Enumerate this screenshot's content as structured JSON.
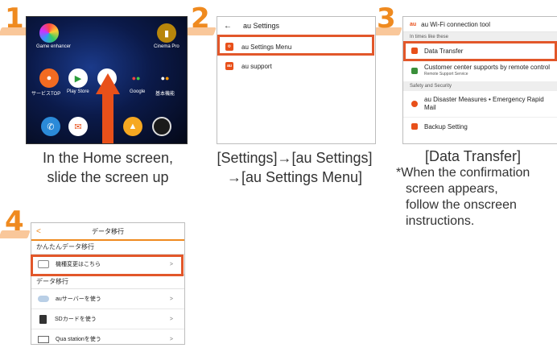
{
  "steps": [
    "1",
    "2",
    "3",
    "4"
  ],
  "home": {
    "top_apps": [
      "Game enhancer",
      "Cinema Pro"
    ],
    "dock_apps": [
      "サービスTOP",
      "Play Store",
      "",
      "Google",
      "基本機能"
    ]
  },
  "settings": {
    "back_glyph": "←",
    "title": "au Settings",
    "items": [
      "au Settings Menu",
      "au support"
    ]
  },
  "wifi": {
    "title": "au Wi-Fi connection tool",
    "section1": "In times like these",
    "items1": [
      {
        "label": "Data Transfer",
        "sub": ""
      },
      {
        "label": "Customer center supports by remote control",
        "sub": "Remote Support Service"
      }
    ],
    "section2": "Safety and Security",
    "items2": [
      {
        "label": "au Disaster Measures • Emergency Rapid Mail",
        "sub": ""
      },
      {
        "label": "Backup Setting",
        "sub": ""
      }
    ]
  },
  "migrate": {
    "back_glyph": "<",
    "title": "データ移行",
    "section1": "かんたんデータ移行",
    "items1": [
      "機種変更はこちら"
    ],
    "section2": "データ移行",
    "items2": [
      "auサーバーを使う",
      "SDカードを使う",
      "Qua stationを使う"
    ],
    "chevron": ">"
  },
  "captions": {
    "step1": [
      "In the Home screen,",
      "slide the screen up"
    ],
    "step2": [
      "[Settings]→[au Settings]",
      "→[au Settings Menu]"
    ],
    "step3": [
      "[Data Transfer]",
      "*When the confirmation",
      "screen appears,",
      "follow the onscreen",
      "instructions."
    ]
  },
  "colors": {
    "accent": "#ef8a1f",
    "highlight": "#e2572a",
    "arrow": "#e8501a"
  }
}
